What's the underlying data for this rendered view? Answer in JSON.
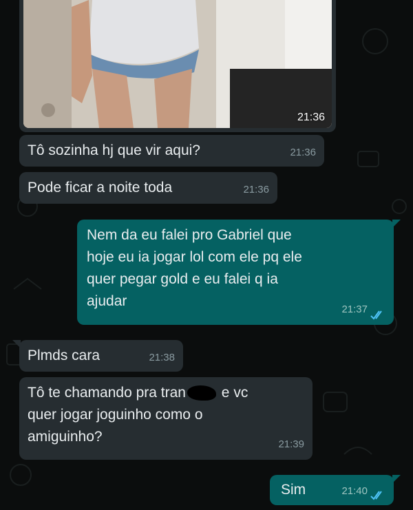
{
  "photo": {
    "time": "21:36"
  },
  "messages": [
    {
      "id": "m1",
      "dir": "in",
      "text": "Tô sozinha hj que vir aqui?",
      "time": "21:36"
    },
    {
      "id": "m2",
      "dir": "in",
      "text": "Pode ficar a noite toda",
      "time": "21:36"
    },
    {
      "id": "m3",
      "dir": "out",
      "text": "Nem da eu falei pro Gabriel que\nhoje eu ia jogar lol com ele pq ele\nquer pegar gold e eu falei q ia\najudar",
      "time": "21:37"
    },
    {
      "id": "m4",
      "dir": "in",
      "text": "Plmds cara",
      "time": "21:38"
    },
    {
      "id": "m5",
      "dir": "in",
      "text_before": "Tô te chamando pra tran",
      "text_after": " e vc\nquer jogar joguinho como o\namiguinho?",
      "time": "21:39"
    },
    {
      "id": "m6",
      "dir": "out",
      "text": "Sim",
      "time": "21:40"
    }
  ],
  "colors": {
    "incoming": "#262d31",
    "outgoing": "#056162",
    "background": "#0b0d0d",
    "read_ticks": "#4fc3f7"
  }
}
